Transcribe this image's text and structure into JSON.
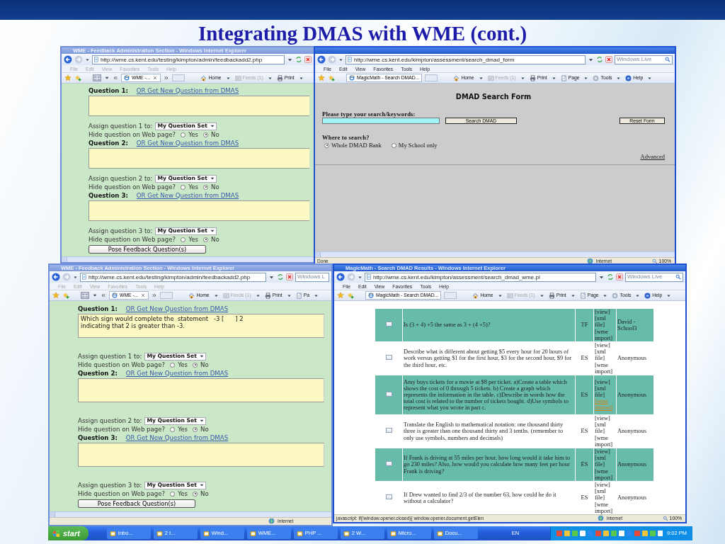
{
  "slide": {
    "title": "Integrating DMAS with WME  (cont.)"
  },
  "windows": [
    {
      "kind": "feedback",
      "active": false,
      "title": "WME - Feedback Administration Section - Windows Internet Explorer",
      "url": "http://wme.cs.kent.edu/testing/kimpton/admin/feedbackadd2.php",
      "menu": [
        "File",
        "Edit",
        "View",
        "Favorites",
        "Tools",
        "Help"
      ],
      "quick_tabs": true,
      "tab": {
        "label": "WME -...",
        "closable": true
      },
      "commands": [
        {
          "kind": "home",
          "label": "Home",
          "disabled": false
        },
        {
          "kind": "feeds",
          "label": "Feeds (1)",
          "disabled": true
        },
        {
          "kind": "print",
          "label": "Print",
          "disabled": false
        }
      ],
      "questions": [
        {
          "label": "Question 1:",
          "link": "OR Get New Question from DMAS",
          "assign_label": "Assign question 1 to:",
          "set": "My Question Set",
          "hide_label": "Hide question on Web page?",
          "options": [
            {
              "label": "Yes",
              "selected": false
            },
            {
              "label": "No",
              "selected": true
            }
          ]
        },
        {
          "label": "Question 2:",
          "link": "OR Get New Question from DMAS",
          "assign_label": "Assign question 2 to:",
          "set": "My Question Set",
          "hide_label": "Hide question on Web page?",
          "options": [
            {
              "label": "Yes",
              "selected": false
            },
            {
              "label": "No",
              "selected": true
            }
          ]
        },
        {
          "label": "Question 3:",
          "link": "OR Get New Question from DMAS",
          "assign_label": "Assign question 3 to:",
          "set": "My Question Set",
          "hide_label": "Hide question on Web page?",
          "options": [
            {
              "label": "Yes",
              "selected": false
            },
            {
              "label": "No",
              "selected": true
            }
          ]
        }
      ],
      "submit": "Pose Feedback Question(s)",
      "scrollbar": true
    },
    {
      "kind": "search_form",
      "active": true,
      "url": "http://wme.cs.kent.edu/kimpton/assessment/search_dmad_form",
      "search_placeholder": "Windows Live",
      "menu": [
        "File",
        "Edit",
        "View",
        "Favorites",
        "Tools",
        "Help"
      ],
      "quick_tabs": false,
      "tab": {
        "label": "MagicMath - Search DMAD...",
        "closable": false
      },
      "commands": [
        {
          "kind": "home",
          "label": "Home",
          "disabled": false
        },
        {
          "kind": "feeds",
          "label": "Feeds (1)",
          "disabled": true
        },
        {
          "kind": "print",
          "label": "Print",
          "disabled": false
        },
        {
          "kind": "page",
          "label": "Page",
          "disabled": false
        },
        {
          "kind": "tools",
          "label": "Tools",
          "disabled": false
        },
        {
          "kind": "help",
          "label": "Help",
          "disabled": false
        }
      ],
      "form": {
        "heading": "DMAD Search Form",
        "prompt": "Please type your search/keywords:",
        "search_button": "Search DMAD",
        "reset_button": "Reset Form",
        "where_label": "Where to search?",
        "options": [
          {
            "label": "Whole DMAD Bank",
            "selected": true
          },
          {
            "label": "My School only",
            "selected": false
          }
        ],
        "advanced": "Advanced"
      },
      "scrollbar": true,
      "status": {
        "text": "Done",
        "zone": "Internet",
        "zoom": "100%"
      }
    },
    {
      "kind": "feedback",
      "active": false,
      "title": "WME - Feedback Administration Section - Windows Internet Explorer",
      "url": "http://wme.cs.kent.edu/testing/kimpton/admin/feedbackadd2.php",
      "search_placeholder": "Windows L",
      "menu": [
        "File",
        "Edit",
        "View",
        "Favorites",
        "Tools",
        "Help"
      ],
      "quick_tabs": true,
      "tab": {
        "label": "WME -...",
        "closable": true
      },
      "commands": [
        {
          "kind": "home",
          "label": "Home",
          "disabled": false
        },
        {
          "kind": "feeds",
          "label": "Feeds (1)",
          "disabled": true
        },
        {
          "kind": "print",
          "label": "Print",
          "disabled": false
        },
        {
          "kind": "page",
          "label": "Pa",
          "disabled": false
        }
      ],
      "questions": [
        {
          "label": "Question 1:",
          "link": "OR Get New Question from DMAS",
          "text": "Which sign would complete the  statement   -3 [      ] 2\nindicating that 2 is greater than -3.",
          "assign_label": "Assign question 1 to:",
          "set": "My Question Set",
          "hide_label": "Hide question on Web page?",
          "options": [
            {
              "label": "Yes",
              "selected": false
            },
            {
              "label": "No",
              "selected": true
            }
          ]
        },
        {
          "label": "Question 2:",
          "link": "OR Get New Question from DMAS",
          "assign_label": "Assign question 2 to:",
          "set": "My Question Set",
          "hide_label": "Hide question on Web page?",
          "options": [
            {
              "label": "Yes",
              "selected": false
            },
            {
              "label": "No",
              "selected": true
            }
          ]
        },
        {
          "label": "Question 3:",
          "link": "OR Get New Question from DMAS",
          "assign_label": "Assign question 3 to:",
          "set": "My Question Set",
          "hide_label": "Hide question on Web page?",
          "options": [
            {
              "label": "Yes",
              "selected": false
            },
            {
              "label": "No",
              "selected": true
            }
          ]
        }
      ],
      "submit": "Pose Feedback Question(s)",
      "scrollbar": true,
      "status": {
        "zone": "Internet"
      }
    },
    {
      "kind": "results",
      "active": true,
      "title": "MagicMath - Search DMAD Results - Windows Internet Explorer",
      "url": "http://wme.cs.kent.edu/kimpton/assessment/search_dmad_wme.pl",
      "search_placeholder": "Windows Live",
      "menu": [
        "File",
        "Edit",
        "View",
        "Favorites",
        "Tools",
        "Help"
      ],
      "quick_tabs": false,
      "tab": {
        "label": "MagicMath - Search DMAD...",
        "closable": false
      },
      "commands": [
        {
          "kind": "home",
          "label": "Home",
          "disabled": false
        },
        {
          "kind": "feeds",
          "label": "Feeds (1)",
          "disabled": true
        },
        {
          "kind": "print",
          "label": "Print",
          "disabled": false
        },
        {
          "kind": "page",
          "label": "Page",
          "disabled": false
        },
        {
          "kind": "tools",
          "label": "Tools",
          "disabled": false
        },
        {
          "kind": "help",
          "label": "Help",
          "disabled": false
        }
      ],
      "rows": [
        {
          "highlighted": true,
          "checked": false,
          "question": "Is (3 + 4) +5 the same as 3 + (4 +5)?",
          "type": "TF",
          "links": [
            "[view]",
            "[xml file]",
            "[wme import]"
          ],
          "visited": false,
          "author": "David - School3"
        },
        {
          "highlighted": false,
          "checked": false,
          "question": "Describe what is different about getting $5 every hour for 20 hours of work versus getting $1 for the first hour, $3 for the second hour, $9 for the third hour, etc.",
          "type": "ES",
          "links": [
            "[view]",
            "[xml file]",
            "[wme import]"
          ],
          "visited": false,
          "author": "Anonymous"
        },
        {
          "highlighted": true,
          "checked": false,
          "question": "Amy buys tickets for a movie at $8 per ticket. a)Create a table which shows the cost of 0 through 5 tickets. b) Create a graph which represents the information in the table. c)Describe in words how the total cost is related to the number of tickets bought. d)Use symbols to represent what you wrote in part c.",
          "type": "ES",
          "links": [
            "[view]",
            "[xml file]",
            "[wme import]"
          ],
          "visited": true,
          "author": "Anonymous"
        },
        {
          "highlighted": false,
          "checked": false,
          "question": "Translate the English to mathematical notation: one thousand thirty three is greater than one thousand thirty and 3 tenths. (remember to only use symbols, numbers and decimals)",
          "type": "ES",
          "links": [
            "[view]",
            "[xml file]",
            "[wme import]"
          ],
          "visited": false,
          "author": "Anonymous"
        },
        {
          "highlighted": true,
          "checked": false,
          "question": "If Frank is driving at 55 miles per hour, how long would it take him to go 230 miles? Also, how would you calculate how many feet per hour Frank is driving?",
          "type": "ES",
          "links": [
            "[view]",
            "[xml file]",
            "[wme import]"
          ],
          "visited": false,
          "author": "Anonymous"
        },
        {
          "highlighted": false,
          "checked": false,
          "question": "If Drew wanted to find 2/3 of the number 63, how could he do it without a calculator?",
          "type": "ES",
          "links": [
            "[view]",
            "[xml file]",
            "[wme import]"
          ],
          "visited": false,
          "author": "Anonymous"
        }
      ],
      "scrollbar": false,
      "status": {
        "text": "javascript: if(!window.opener.closed){ window.opener.document.getElen",
        "zone": "Internet",
        "zoom": "100%"
      }
    }
  ],
  "taskbar": {
    "start": "start",
    "items": [
      "Inbo...",
      "2 I...",
      "Wind...",
      "WME...",
      "PHP ...",
      "2 W...",
      "Micro...",
      "Docu..."
    ],
    "language": "EN",
    "clock": "9:02 PM"
  }
}
